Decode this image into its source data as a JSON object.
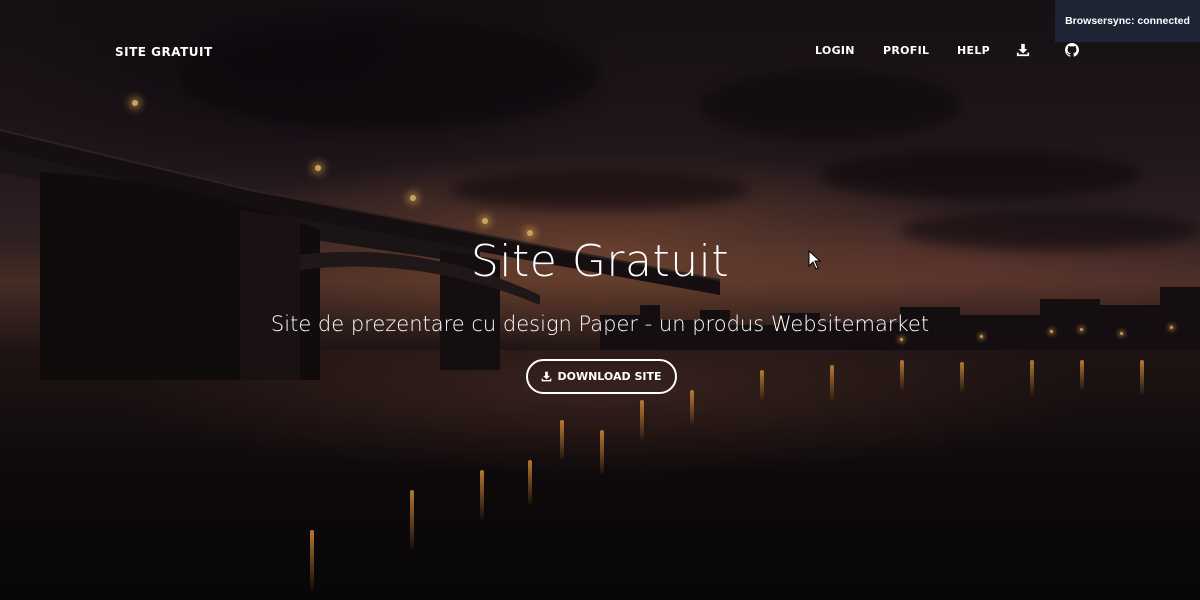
{
  "navbar": {
    "brand": "SITE GRATUIT",
    "links": [
      {
        "label": "LOGIN"
      },
      {
        "label": "PROFIL"
      },
      {
        "label": "HELP"
      }
    ],
    "icons": [
      "download-icon",
      "github-icon"
    ]
  },
  "hero": {
    "title": "Site Gratuit",
    "subtitle": "Site de prezentare cu design Paper - un produs Websitemarket",
    "button_label": "DOWNLOAD SITE",
    "button_icon": "download-icon"
  },
  "notification": {
    "text": "Browsersync: connected"
  },
  "colors": {
    "text": "#ffffff",
    "notification_bg": "#1f2535"
  }
}
